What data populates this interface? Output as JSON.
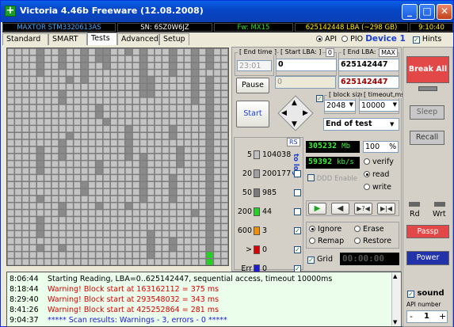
{
  "window": {
    "title": "Victoria 4.46b Freeware (12.08.2008)",
    "icon": "plus-cross-icon"
  },
  "infobar": {
    "model": "MAXTOR STM3320613AS",
    "serial": "SN: 6SZ0W6JZ",
    "firmware": "Fw: MX15",
    "lba": "625142448 LBA (~298 GB)",
    "time": "9:10:40"
  },
  "tabs": [
    "Standard",
    "SMART",
    "Tests",
    "Advanced",
    "Setup"
  ],
  "mode": {
    "api": "API",
    "pio": "PIO",
    "device": "Device 1",
    "hints": "Hints"
  },
  "scan": {
    "end_time_label": "[ End time ]",
    "end_time_value": "23:01",
    "start_lba_label": "[ Start LBA: ]",
    "start_lba_badge": "0",
    "start_lba_value": "0",
    "end_lba_label": "[ End LBA: ]",
    "end_lba_badge": "MAX",
    "end_lba_value": "625142447",
    "end_lba_value2": "625142447",
    "second_start_value": "0",
    "pause": "Pause",
    "start": "Start",
    "block_size_label": "[ block size ]",
    "block_size_value": "2048",
    "timeout_label": "[ timeout,ms ]",
    "timeout_value": "10000",
    "end_action": "End of test"
  },
  "legend": {
    "rs": "RS",
    "to_log": "to log:",
    "rows": [
      {
        "label": "5",
        "count": "104038",
        "color": "#c0c0c0"
      },
      {
        "label": "20",
        "count": "200177",
        "color": "#a0a0a0"
      },
      {
        "label": "50",
        "count": "985",
        "color": "#7a7a7a"
      },
      {
        "label": "200",
        "count": "44",
        "color": "#22d322"
      },
      {
        "label": "600",
        "count": "3",
        "color": "#f28c00"
      },
      {
        "label": ">",
        "count": "0",
        "color": "#e00000"
      },
      {
        "label": "Err",
        "count": "0",
        "color": "#1a1ad8"
      }
    ]
  },
  "stats": {
    "mb": "305232",
    "mb_unit": "Mb",
    "percent": "100",
    "percent_unit": "%",
    "speed": "59392",
    "speed_unit": "kb/s",
    "ddd": "DDD Enable",
    "verify": "verify",
    "read": "read",
    "write": "write"
  },
  "actions": {
    "ignore": "Ignore",
    "erase": "Erase",
    "remap": "Remap",
    "restore": "Restore",
    "grid": "Grid",
    "timer": "00:00:00"
  },
  "right": {
    "break_all": "Break All",
    "sleep": "Sleep",
    "recall": "Recall",
    "rd": "Rd",
    "wrt": "Wrt",
    "passp": "Passp",
    "power": "Power",
    "sound": "sound",
    "api_number_label": "API number",
    "api_number_value": "1"
  },
  "log": [
    {
      "time": "8:06:44",
      "text": "Starting Reading, LBA=0..625142447, sequential access, timeout 10000ms",
      "color": "#000000"
    },
    {
      "time": "8:18:44",
      "text": "Warning! Block start at 163162112 = 375 ms",
      "color": "#e00000"
    },
    {
      "time": "8:29:40",
      "text": "Warning! Block start at 293548032 = 343 ms",
      "color": "#e00000"
    },
    {
      "time": "8:41:26",
      "text": "Warning! Block start at 425252864 = 281 ms",
      "color": "#e00000"
    },
    {
      "time": "9:04:37",
      "text": "***** Scan results: Warnings - 3, errors - 0 *****",
      "color": "#1a1ad8"
    }
  ]
}
